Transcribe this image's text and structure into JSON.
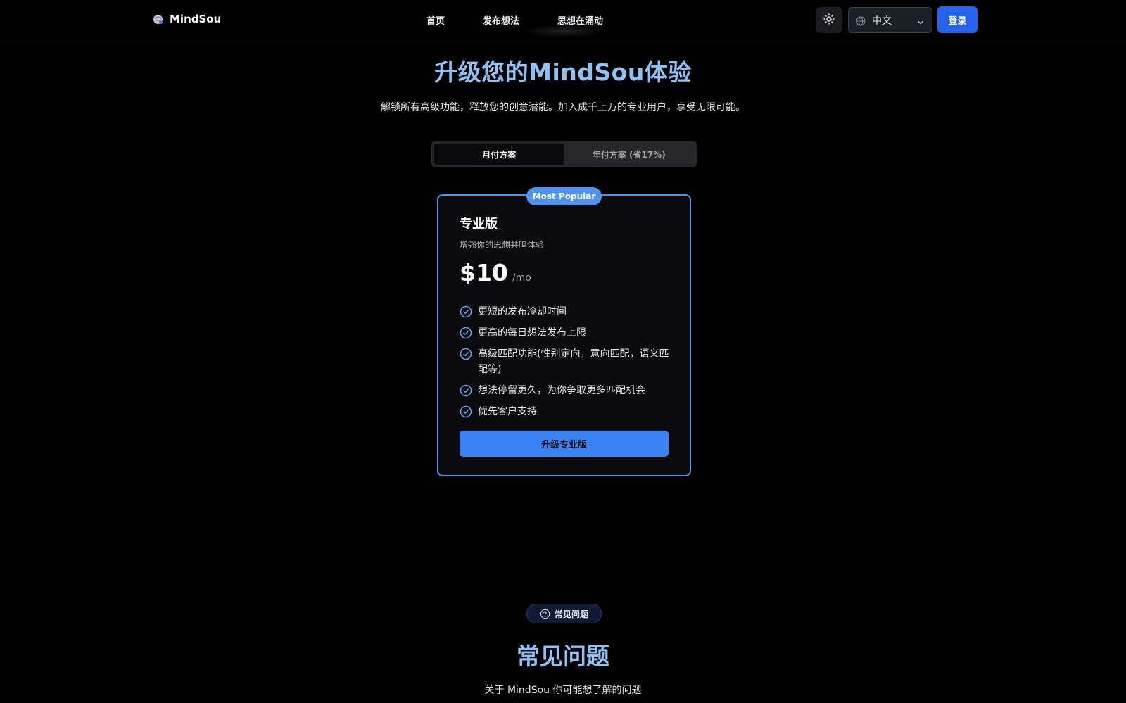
{
  "header": {
    "brand": "MindSou",
    "nav": [
      "首页",
      "发布想法",
      "思想在涌动"
    ],
    "language": "中文",
    "login_label": "登录"
  },
  "hero": {
    "title": "升级您的MindSou体验",
    "subtitle": "解锁所有高级功能，释放您的创意潜能。加入成千上万的专业用户，享受无限可能。"
  },
  "billing_toggle": {
    "monthly": "月付方案",
    "yearly": "年付方案 (省17%)",
    "selected": "monthly"
  },
  "plan": {
    "badge": "Most Popular",
    "name": "专业版",
    "description": "增强你的思想共鸣体验",
    "price": "$10",
    "period": "/mo",
    "features": [
      "更短的发布冷却时间",
      "更高的每日想法发布上限",
      "高级匹配功能(性别定向，意向匹配，语义匹配等)",
      "想法停留更久，为你争取更多匹配机会",
      "优先客户支持"
    ],
    "cta": "升级专业版"
  },
  "faq": {
    "pill_label": "常见问题",
    "title": "常见问题",
    "subtitle": "关于 MindSou 你可能想了解的问题"
  },
  "colors": {
    "accent": "#3b82f6",
    "login_button": "#2563eb",
    "card_border": "#4f94ea",
    "heading": "#8ec2f4",
    "background": "#000000"
  },
  "icons": {
    "brand": "brain-logo-icon",
    "theme": "sun-icon",
    "language": "globe-icon",
    "dropdown": "chevron-down-icon",
    "feature": "check-circle-icon",
    "faq": "question-circle-icon"
  }
}
